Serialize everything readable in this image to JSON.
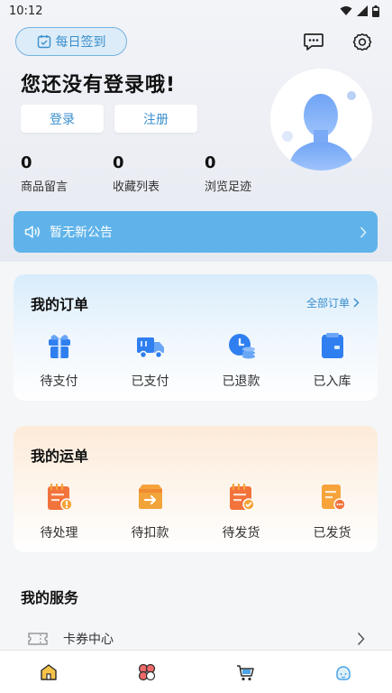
{
  "status_bar": {
    "time": "10:12"
  },
  "header": {
    "signin_label": "每日签到",
    "login_prompt": "您还没有登录哦!",
    "login_label": "登录",
    "register_label": "注册",
    "stats": [
      {
        "value": "0",
        "label": "商品留言"
      },
      {
        "value": "0",
        "label": "收藏列表"
      },
      {
        "value": "0",
        "label": "浏览足迹"
      }
    ]
  },
  "notice": {
    "text": "暂无新公告"
  },
  "orders": {
    "title": "我的订单",
    "all_label": "全部订单",
    "items": [
      {
        "label": "待支付",
        "icon": "gift-box-icon"
      },
      {
        "label": "已支付",
        "icon": "delivery-truck-icon"
      },
      {
        "label": "已退款",
        "icon": "refund-clock-icon"
      },
      {
        "label": "已入库",
        "icon": "warehouse-bag-icon"
      }
    ]
  },
  "shipping": {
    "title": "我的运单",
    "items": [
      {
        "label": "待处理",
        "icon": "pending-notebook-icon"
      },
      {
        "label": "待扣款",
        "icon": "deduct-box-icon"
      },
      {
        "label": "待发货",
        "icon": "to-ship-notebook-icon"
      },
      {
        "label": "已发货",
        "icon": "shipped-document-icon"
      }
    ]
  },
  "services": {
    "title": "我的服务",
    "rows": [
      {
        "label": "卡券中心",
        "icon": "ticket-icon"
      }
    ]
  },
  "tab_bar": {
    "tabs": [
      {
        "icon": "home-icon",
        "active": false
      },
      {
        "icon": "category-icon",
        "active": false
      },
      {
        "icon": "cart-icon",
        "active": false
      },
      {
        "icon": "profile-icon",
        "active": true
      }
    ]
  },
  "colors": {
    "accent_blue": "#3a8fcc",
    "notice_blue": "#5fb3ea",
    "order_icon_blue": "#2f7ff0",
    "ship_icon_orange": "#f2733b",
    "ship_icon_amber": "#f6a33a"
  }
}
